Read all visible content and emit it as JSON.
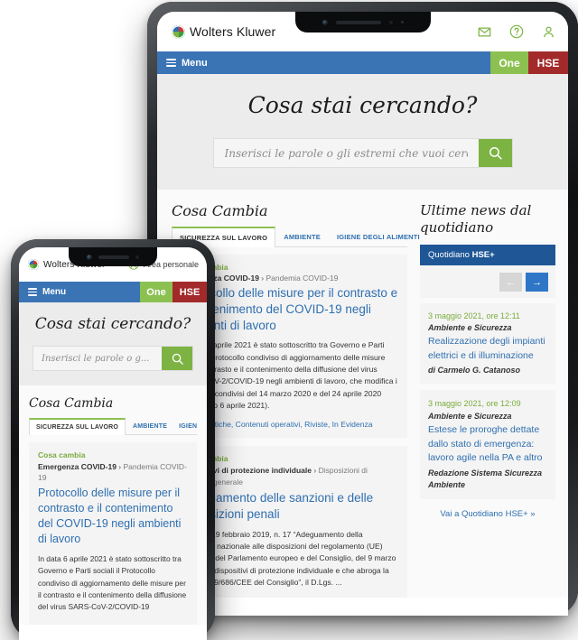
{
  "brand": {
    "name": "Wolters Kluwer",
    "logo_icon": "wolters-kluwer-globe-icon",
    "accent_blue": "#3a74b5",
    "accent_green": "#8cc152",
    "accent_red": "#a32a2a",
    "link_blue": "#2f6fb0",
    "rail_blue": "#1f5796"
  },
  "tablet": {
    "header": {
      "icons": [
        {
          "name": "mail-icon",
          "glyph": "envelope"
        },
        {
          "name": "help-icon",
          "glyph": "question-circle"
        },
        {
          "name": "account-icon",
          "glyph": "person"
        }
      ]
    },
    "navbar": {
      "menu_label": "Menu",
      "one_label": "One",
      "hse_label": "HSE"
    },
    "hero": {
      "title": "Cosa stai cercando?",
      "search_placeholder": "Inserisci le parole o gli estremi che vuoi cercare",
      "search_value": "",
      "search_icon": "search-icon"
    },
    "cosa_cambia": {
      "section_title": "Cosa Cambia",
      "tabs": [
        {
          "label": "SICUREZZA SUL LAVORO",
          "active": true
        },
        {
          "label": "AMBIENTE",
          "active": false
        },
        {
          "label": "IGIENE DEGLI ALIMENTI",
          "active": false
        }
      ],
      "articles": [
        {
          "kicker": "Cosa cambia",
          "crumb_main": "Emergenza COVID-19",
          "crumb_sep": "›",
          "crumb_sub": "Pandemia COVID-19",
          "headline": "Protocollo delle misure per il contrasto e il contenimento del COVID-19 negli ambienti di lavoro",
          "body": "In data 6 aprile 2021 è stato sottoscritto tra Governo e Parti sociali il Protocollo condiviso di aggiornamento delle misure per il contrasto e il contenimento della diffusione del virus SARS-CoV-2/COVID-19 negli ambienti di lavoro, che modifica i Protocolli condivisi del 14 marzo 2020 e del 24 aprile 2020 (Protocollo 6 aprile 2021).",
          "tags": "Guide pratiche, Contenuti operativi, Riviste, In Evidenza"
        },
        {
          "kicker": "Cosa cambia",
          "crumb_main": "Dispositivi di protezione individuale",
          "crumb_sep": "›",
          "crumb_sub": "Disposizioni di carattere generale",
          "headline": "Adeguamento delle sanzioni e delle disposizioni penali",
          "body": "Il D.Lgs. 19 febbraio 2019, n. 17 “Adeguamento della normativa nazionale alle disposizioni del regolamento (UE) 2016/425 del Parlamento europeo e del Consiglio, del 9 marzo 2016, sui dispositivi di protezione individuale e che abroga la direttiva 89/686/CEE del Consiglio”, il D.Lgs. ...",
          "tags": ""
        }
      ]
    },
    "rail": {
      "title": "Ultime news dal quotidiano",
      "head_prefix": "Quotidiano ",
      "head_strong": "HSE+",
      "prev_label": "←",
      "next_label": "→",
      "items": [
        {
          "date": "3 maggio 2021, ore 12:11",
          "category": "Ambiente e Sicurezza",
          "title": "Realizzazione degli impianti elettrici e di illuminazione",
          "author": "di Carmelo G. Catanoso"
        },
        {
          "date": "3 maggio 2021, ore 12:09",
          "category": "Ambiente e Sicurezza",
          "title": "Estese le proroghe dettate dallo stato di emergenza: lavoro agile nella PA e altro",
          "author": "Redazione Sistema Sicurezza Ambiente"
        }
      ],
      "more_link": "Vai a Quotidiano HSE+  »"
    }
  },
  "phone": {
    "header": {
      "area_label": "Area personale",
      "area_icon": "account-circle-icon"
    },
    "navbar": {
      "menu_label": "Menu",
      "one_label": "One",
      "hse_label": "HSE"
    },
    "hero": {
      "title": "Cosa stai cercando?",
      "search_placeholder": "Inserisci le parole o g...",
      "search_value": "",
      "search_icon": "search-icon"
    },
    "cosa_cambia": {
      "section_title": "Cosa Cambia",
      "tabs": [
        {
          "label": "SICUREZZA SUL LAVORO",
          "active": true
        },
        {
          "label": "AMBIENTE",
          "active": false
        },
        {
          "label": "IGIEN",
          "active": false
        }
      ],
      "article": {
        "kicker": "Cosa cambia",
        "crumb_main": "Emergenza COVID-19",
        "crumb_sep": "›",
        "crumb_sub": "Pandemia COVID-19",
        "headline": "Protocollo delle misure per il contrasto e il contenimento del COVID-19 negli ambienti di lavoro",
        "body": "In data 6 aprile 2021 è stato sottoscritto tra Governo e Parti sociali il Protocollo condiviso di aggiornamento delle misure per il contrasto e il contenimento della diffusione del virus SARS-CoV-2/COVID-19"
      }
    }
  }
}
